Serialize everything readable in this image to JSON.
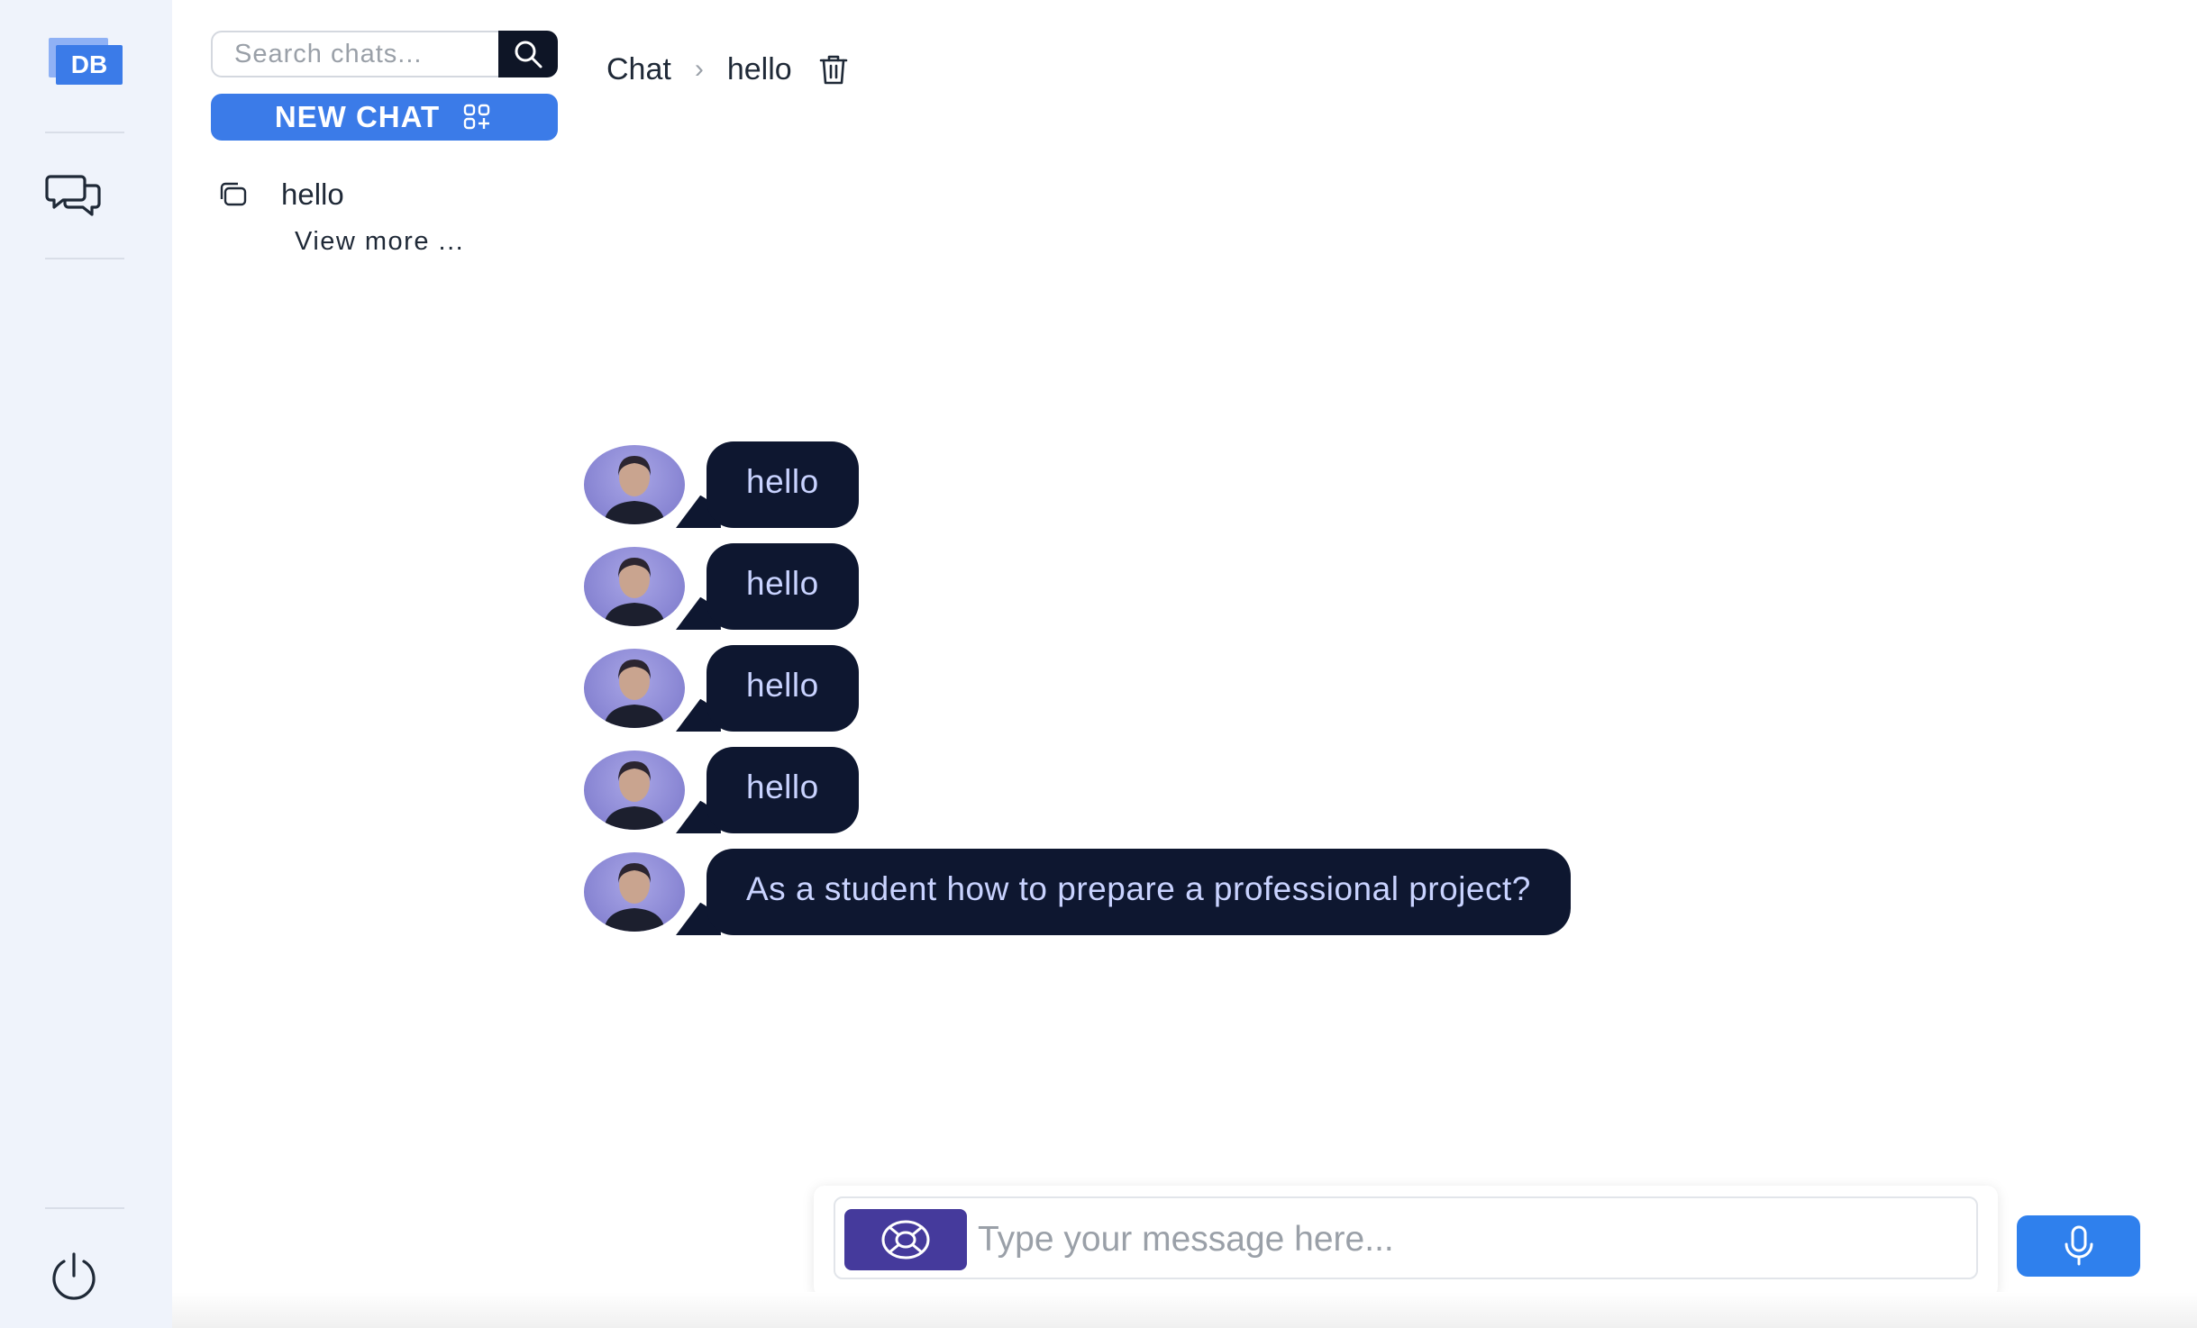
{
  "rail": {
    "logo_text": "DB",
    "icons": [
      "logo-icon",
      "chat-bubbles-icon",
      "power-icon"
    ]
  },
  "search": {
    "placeholder": "Search chats..."
  },
  "new_chat": {
    "label": "NEW CHAT",
    "icon": "grid-plus-icon"
  },
  "chat_list": {
    "items": [
      {
        "label": "hello",
        "icon": "copy-icon"
      }
    ],
    "view_more": "View more ..."
  },
  "breadcrumb": {
    "root": "Chat",
    "current": "hello",
    "delete_icon": "trash-icon"
  },
  "messages": [
    {
      "text": "hello"
    },
    {
      "text": "hello"
    },
    {
      "text": "hello"
    },
    {
      "text": "hello"
    },
    {
      "text": "As a student how to prepare a professional project?"
    }
  ],
  "composer": {
    "placeholder": "Type your message here...",
    "attach_icon": "lifebuoy-icon",
    "mic_icon": "microphone-icon"
  },
  "colors": {
    "accent": "#3b7be8",
    "bubble": "#0e1730",
    "bubble_text": "#c9d3ff",
    "attach": "#453a9c",
    "mic": "#2f80ed",
    "rail_bg": "#eff3fb"
  }
}
